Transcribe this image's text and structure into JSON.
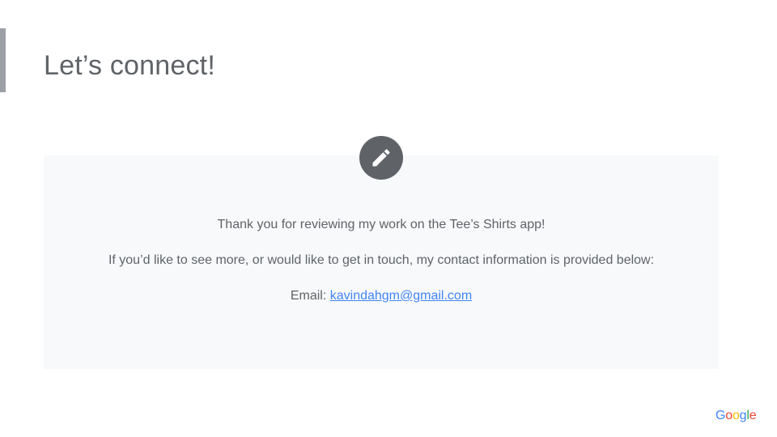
{
  "slide": {
    "title": "Let’s connect!",
    "edit_icon": "pencil-icon",
    "card": {
      "line1": "Thank you for reviewing my work on the Tee’s Shirts app!",
      "line2": "If you’d like to see more, or would like to get in touch, my contact information is provided below:",
      "email_label": "Email: ",
      "email": "kavindahgm@gmail.com"
    },
    "logo": {
      "letters": [
        "G",
        "o",
        "o",
        "g",
        "l",
        "e"
      ],
      "colors": [
        "#4285f4",
        "#ea4335",
        "#fbbc05",
        "#4285f4",
        "#34a853",
        "#ea4335"
      ]
    }
  },
  "colors": {
    "accent_bar": "#9aa0a6",
    "text": "#5f6368",
    "card_bg": "#f8f9fa",
    "badge_bg": "#5f6368",
    "link": "#4285f4"
  }
}
